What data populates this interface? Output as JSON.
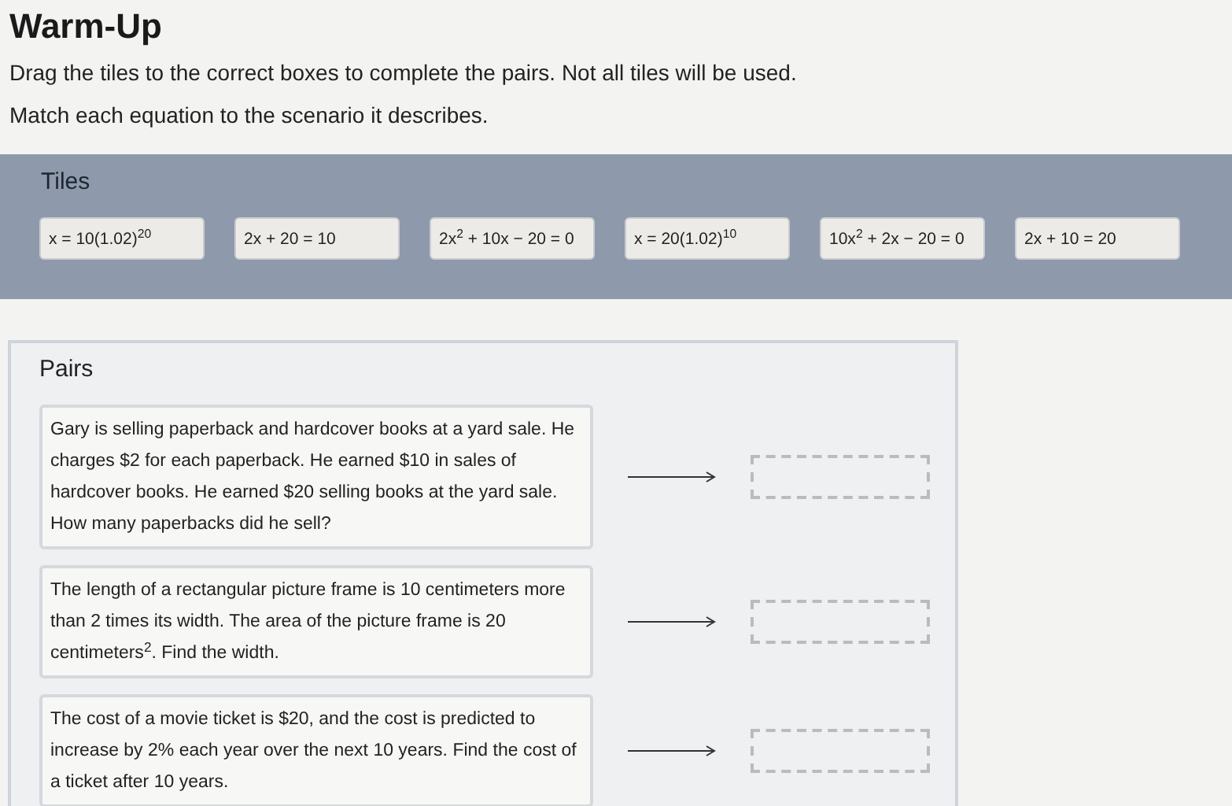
{
  "title": "Warm-Up",
  "instructions": [
    "Drag the tiles to the correct boxes to complete the pairs. Not all tiles will be used.",
    "Match each equation to the scenario it describes."
  ],
  "tiles": {
    "heading": "Tiles",
    "items": [
      "x = 10(1.02)$^{20}$",
      "2x + 20 = 10",
      "2x$^{2}$ + 10x − 20 = 0",
      "x = 20(1.02)$^{10}$",
      "10x$^{2}$ + 2x − 20 = 0",
      "2x + 10 = 20"
    ]
  },
  "pairs": {
    "heading": "Pairs",
    "items": [
      {
        "scenario": "Gary is selling paperback and hardcover books at a yard sale. He charges $2 for each paperback. He earned $10 in sales of hardcover books. He earned $20 selling books at the yard sale. How many paperbacks did he sell?"
      },
      {
        "scenario": "The length of a rectangular picture frame is 10 centimeters more than 2 times its width. The area of the picture frame is 20 centimeters$^{2}$. Find the width."
      },
      {
        "scenario": "The cost of a movie ticket is $20, and the cost is predicted to increase by 2% each year over the next 10 years. Find the cost of a ticket after 10 years."
      }
    ]
  }
}
